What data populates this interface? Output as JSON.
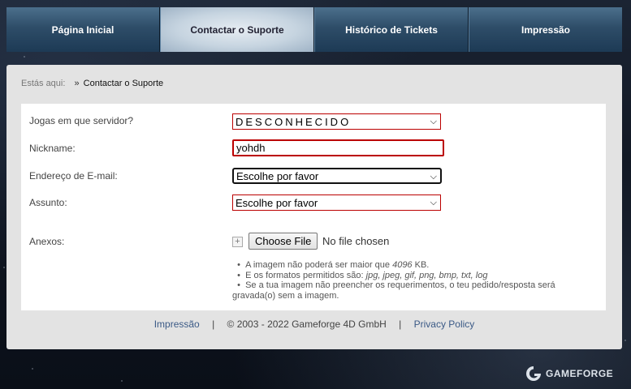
{
  "nav": {
    "tabs": [
      {
        "label": "Página Inicial",
        "active": false
      },
      {
        "label": "Contactar o Suporte",
        "active": true
      },
      {
        "label": "Histórico de Tickets",
        "active": false
      },
      {
        "label": "Impressão",
        "active": false
      }
    ]
  },
  "breadcrumb": {
    "prefix": "Estás aqui:",
    "separator": "»",
    "current": "Contactar o Suporte"
  },
  "form": {
    "server": {
      "label": "Jogas em que servidor?",
      "value": "DESCONHECIDO"
    },
    "nickname": {
      "label": "Nickname:",
      "value": "yohdh"
    },
    "email": {
      "label": "Endereço de E-mail:",
      "value": "Escolhe por favor"
    },
    "subject": {
      "label": "Assunto:",
      "value": "Escolhe por favor"
    },
    "attachments": {
      "label": "Anexos:",
      "button_label": "Choose File",
      "status": "No file chosen",
      "notes": {
        "n1_prefix": "A imagem não poderá ser maior que ",
        "n1_size": "4096",
        "n1_suffix": " KB.",
        "n2_prefix": "E os formatos permitidos são: ",
        "n2_formats": "jpg, jpeg, gif, png, bmp, txt, log",
        "n3": "Se a tua imagem não preencher os requerimentos, o teu pedido/resposta será gravada(o) sem a imagem."
      }
    }
  },
  "footer": {
    "link1": "Impressão",
    "divider": "|",
    "copyright": "© 2003 - 2022 Gameforge 4D GmbH",
    "link2": "Privacy Policy"
  },
  "logo": {
    "text": "GAMEFORGE"
  },
  "colors": {
    "error_border": "#bb0000",
    "link": "#3b5a86",
    "nav_active": "#c6d4e0"
  }
}
